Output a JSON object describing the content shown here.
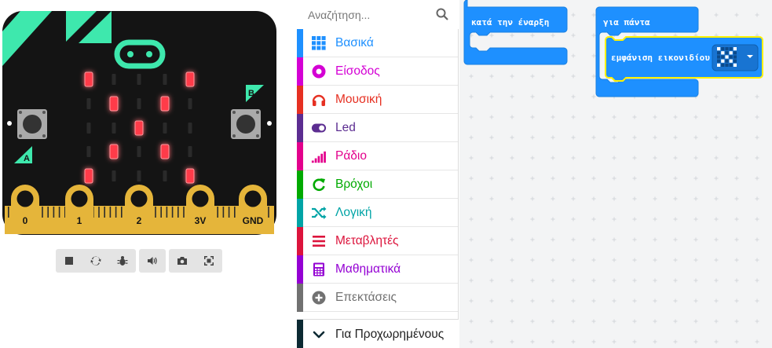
{
  "colors": {
    "board": "#141414",
    "accent_mint": "#3ee8ad",
    "gold": "#e5b53a",
    "led_on": "#ff3b4a",
    "led_off": "#2a2a2a",
    "block_blue": "#1e90ff",
    "workspace_bg": "#f3f4f5"
  },
  "board": {
    "button_a_label": "A",
    "button_b_label": "B",
    "pins": [
      "0",
      "1",
      "2",
      "3V",
      "GND"
    ],
    "led_matrix": [
      [
        1,
        0,
        0,
        0,
        1
      ],
      [
        0,
        1,
        0,
        1,
        0
      ],
      [
        0,
        0,
        1,
        0,
        0
      ],
      [
        0,
        1,
        0,
        1,
        0
      ],
      [
        1,
        0,
        0,
        0,
        1
      ]
    ]
  },
  "sim_toolbar": {
    "groups": [
      [
        {
          "icon": "stop-icon"
        },
        {
          "icon": "restart-icon"
        },
        {
          "icon": "debug-icon"
        }
      ],
      [
        {
          "icon": "sound-icon"
        }
      ],
      [
        {
          "icon": "screenshot-icon"
        },
        {
          "icon": "fullscreen-icon"
        }
      ]
    ]
  },
  "search": {
    "placeholder": "Αναζήτηση...",
    "icon": "search-icon"
  },
  "categories": [
    {
      "label": "Βασικά",
      "color": "#1e90ff",
      "icon": "grid-icon"
    },
    {
      "label": "Είσοδος",
      "color": "#d400d4",
      "icon": "input-circle-icon"
    },
    {
      "label": "Μουσική",
      "color": "#e63022",
      "icon": "headphones-icon"
    },
    {
      "label": "Led",
      "color": "#5c2d91",
      "icon": "toggle-icon"
    },
    {
      "label": "Ράδιο",
      "color": "#e3008c",
      "icon": "signal-bars-icon"
    },
    {
      "label": "Βρόχοι",
      "color": "#00aa00",
      "icon": "loop-arrow-icon"
    },
    {
      "label": "Λογική",
      "color": "#00a4a6",
      "icon": "shuffle-icon"
    },
    {
      "label": "Μεταβλητές",
      "color": "#dc143c",
      "icon": "lines-icon"
    },
    {
      "label": "Μαθηματικά",
      "color": "#9400d3",
      "icon": "calculator-icon"
    },
    {
      "label": "Επεκτάσεις",
      "color": "#717171",
      "icon": "plus-circle-icon"
    }
  ],
  "advanced": {
    "label": "Για Προχωρημένους",
    "icon": "chevron-down-icon"
  },
  "workspace": {
    "on_start_label": "κατά την έναρξη",
    "forever_label": "για πάντα",
    "show_icon_label": "εμφάνιση εικονιδίου",
    "icon_preview": [
      [
        1,
        0,
        0,
        0,
        1
      ],
      [
        0,
        1,
        0,
        1,
        0
      ],
      [
        0,
        0,
        1,
        0,
        0
      ],
      [
        0,
        1,
        0,
        1,
        0
      ],
      [
        1,
        0,
        0,
        0,
        1
      ]
    ]
  }
}
